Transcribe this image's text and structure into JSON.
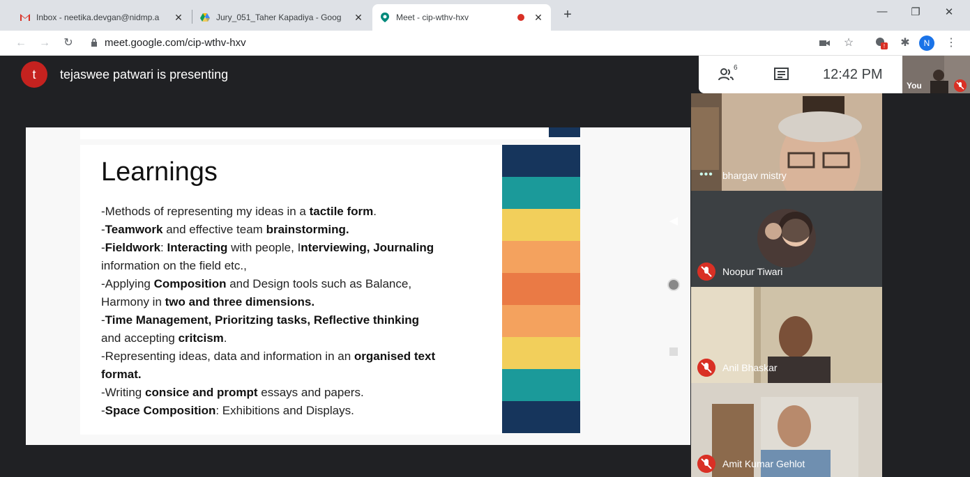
{
  "browser": {
    "tabs": [
      {
        "title": "Inbox - neetika.devgan@nidmp.a",
        "icon": "gmail-icon"
      },
      {
        "title": "Jury_051_Taher Kapadiya - Goog",
        "icon": "drive-icon"
      },
      {
        "title": "Meet - cip-wthv-hxv",
        "icon": "meet-icon",
        "active": true
      }
    ],
    "close_glyph": "✕",
    "new_tab_glyph": "+",
    "url": "meet.google.com/cip-wthv-hxv",
    "profile_initial": "N",
    "window_controls": {
      "minimize": "—",
      "restore": "❐",
      "close": "✕"
    }
  },
  "meet": {
    "presenter_initial": "t",
    "presenting_text": "tejaswee patwari is presenting",
    "time": "12:42 PM",
    "participant_count_badge": "6",
    "self_label": "You",
    "participants": [
      {
        "name": "bhargav mistry",
        "muted": false
      },
      {
        "name": "Noopur Tiwari",
        "muted": true
      },
      {
        "name": "Anil Bhaskar",
        "muted": true
      },
      {
        "name": "Amit Kumar Gehlot",
        "muted": true
      }
    ]
  },
  "slide": {
    "title": "Learnings",
    "lines": [
      [
        {
          "t": "-Methods of representing my ideas in a "
        },
        {
          "t": "tactile form",
          "b": true
        },
        {
          "t": "."
        }
      ],
      [
        {
          "t": "-"
        },
        {
          "t": "Teamwork",
          "b": true
        },
        {
          "t": " and effective team "
        },
        {
          "t": "brainstorming.",
          "b": true
        }
      ],
      [
        {
          "t": "-"
        },
        {
          "t": "Fieldwork",
          "b": true
        },
        {
          "t": ": "
        },
        {
          "t": "Interacting",
          "b": true
        },
        {
          "t": " with people, I"
        },
        {
          "t": "nterviewing, Journaling",
          "b": true
        }
      ],
      [
        {
          "t": "information on the field etc.,"
        }
      ],
      [
        {
          "t": "-Applying "
        },
        {
          "t": "Composition",
          "b": true
        },
        {
          "t": " and Design tools such as Balance,"
        }
      ],
      [
        {
          "t": "Harmony in "
        },
        {
          "t": "two and three dimensions.",
          "b": true
        }
      ],
      [
        {
          "t": "-"
        },
        {
          "t": "Time Management, Prioritzing tasks, Reflective thinking",
          "b": true
        }
      ],
      [
        {
          "t": "and accepting "
        },
        {
          "t": "critcism",
          "b": true
        },
        {
          "t": "."
        }
      ],
      [
        {
          "t": "-Representing ideas, data and information in an "
        },
        {
          "t": "organised text",
          "b": true
        }
      ],
      [
        {
          "t": "format.",
          "b": true
        }
      ],
      [
        {
          "t": "-Writing "
        },
        {
          "t": "consice and prompt",
          "b": true
        },
        {
          "t": " essays and papers."
        }
      ],
      [
        {
          "t": "-"
        },
        {
          "t": "Space Composition",
          "b": true
        },
        {
          "t": ": Exhibitions and Displays."
        }
      ]
    ],
    "band_colors": [
      "#16355c",
      "#1b9a9a",
      "#f2cf5b",
      "#f4a25e",
      "#ea7a45",
      "#f4a25e",
      "#f2cf5b",
      "#1b9a9a",
      "#16355c"
    ]
  },
  "colors": {
    "meet_bg": "#202124",
    "accent_red": "#d93025",
    "chrome_tabbar": "#dee1e6"
  }
}
